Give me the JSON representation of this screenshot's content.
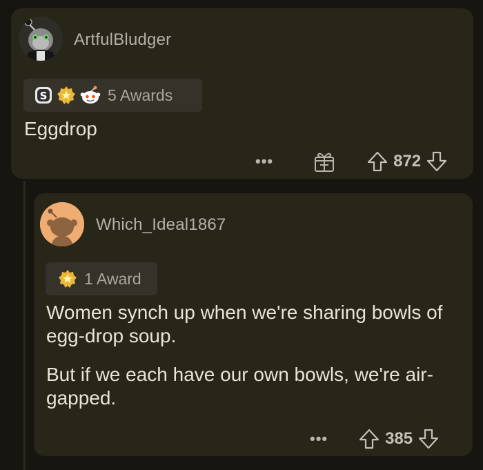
{
  "comments": [
    {
      "username": "ArtfulBludger",
      "awards": {
        "icons": [
          "silver-coin-icon",
          "gold-star-badge-icon",
          "snoo-wholesome-icon"
        ],
        "label": "5 Awards"
      },
      "body": "Eggdrop",
      "more_label": "•••",
      "score": "872"
    },
    {
      "username": "Which_Ideal1867",
      "awards": {
        "icons": [
          "gold-star-badge-icon"
        ],
        "label": "1 Award"
      },
      "body_paragraphs": [
        "Women synch up when we're sharing bowls of egg-drop soup.",
        "But if we each have our own bowls, we're air-gapped."
      ],
      "more_label": "•••",
      "score": "385"
    }
  ],
  "colors": {
    "background": "#16150f",
    "card": "#282519",
    "pill": "#35322a",
    "text": "#e8e4d6",
    "muted": "#b3b1aa",
    "avatar_orange": "#efad74"
  }
}
